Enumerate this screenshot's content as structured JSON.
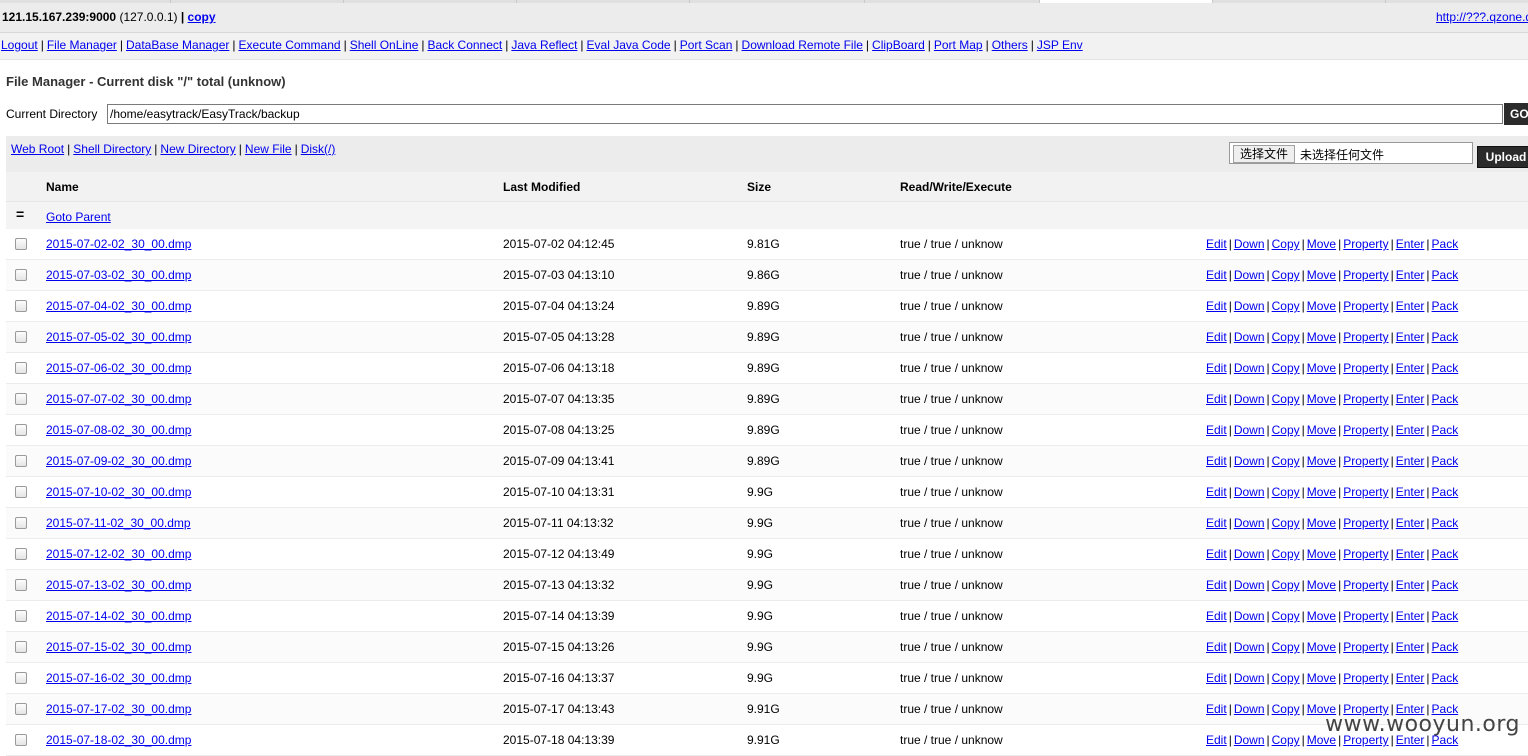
{
  "header": {
    "host": "121.15.167.239:9000",
    "local": "(127.0.0.1)",
    "divider": "|",
    "copy_label": "copy",
    "ext_link": "http://???.qzone.qq.com"
  },
  "nav": [
    "Logout",
    "File Manager",
    "DataBase Manager",
    "Execute Command",
    "Shell OnLine",
    "Back Connect",
    "Java Reflect",
    "Eval Java Code",
    "Port Scan",
    "Download Remote File",
    "ClipBoard",
    "Port Map",
    "Others",
    "JSP Env"
  ],
  "page_title": "File Manager - Current disk \"/\" total (unknow)",
  "current_dir": {
    "label": "Current Directory",
    "value": "/home/easytrack/EasyTrack/backup",
    "go_label": "GO"
  },
  "toolbar": {
    "links": [
      "Web Root",
      "Shell Directory",
      "New Directory",
      "New File",
      "Disk(/)"
    ],
    "choose_file_label": "选择文件",
    "no_file_text": "未选择任何文件",
    "upload_label": "Upload"
  },
  "table": {
    "headers": {
      "name": "Name",
      "modified": "Last Modified",
      "size": "Size",
      "rwx": "Read/Write/Execute"
    },
    "parent_icon": "=",
    "parent_label": "Goto Parent",
    "actions": [
      "Edit",
      "Down",
      "Copy",
      "Move",
      "Property",
      "Enter",
      "Pack"
    ],
    "rows": [
      {
        "name": "2015-07-02-02_30_00.dmp",
        "modified": "2015-07-02 04:12:45",
        "size": "9.81G",
        "rwx": "true / true / unknow"
      },
      {
        "name": "2015-07-03-02_30_00.dmp",
        "modified": "2015-07-03 04:13:10",
        "size": "9.86G",
        "rwx": "true / true / unknow"
      },
      {
        "name": "2015-07-04-02_30_00.dmp",
        "modified": "2015-07-04 04:13:24",
        "size": "9.89G",
        "rwx": "true / true / unknow"
      },
      {
        "name": "2015-07-05-02_30_00.dmp",
        "modified": "2015-07-05 04:13:28",
        "size": "9.89G",
        "rwx": "true / true / unknow"
      },
      {
        "name": "2015-07-06-02_30_00.dmp",
        "modified": "2015-07-06 04:13:18",
        "size": "9.89G",
        "rwx": "true / true / unknow"
      },
      {
        "name": "2015-07-07-02_30_00.dmp",
        "modified": "2015-07-07 04:13:35",
        "size": "9.89G",
        "rwx": "true / true / unknow"
      },
      {
        "name": "2015-07-08-02_30_00.dmp",
        "modified": "2015-07-08 04:13:25",
        "size": "9.89G",
        "rwx": "true / true / unknow"
      },
      {
        "name": "2015-07-09-02_30_00.dmp",
        "modified": "2015-07-09 04:13:41",
        "size": "9.89G",
        "rwx": "true / true / unknow"
      },
      {
        "name": "2015-07-10-02_30_00.dmp",
        "modified": "2015-07-10 04:13:31",
        "size": "9.9G",
        "rwx": "true / true / unknow"
      },
      {
        "name": "2015-07-11-02_30_00.dmp",
        "modified": "2015-07-11 04:13:32",
        "size": "9.9G",
        "rwx": "true / true / unknow"
      },
      {
        "name": "2015-07-12-02_30_00.dmp",
        "modified": "2015-07-12 04:13:49",
        "size": "9.9G",
        "rwx": "true / true / unknow"
      },
      {
        "name": "2015-07-13-02_30_00.dmp",
        "modified": "2015-07-13 04:13:32",
        "size": "9.9G",
        "rwx": "true / true / unknow"
      },
      {
        "name": "2015-07-14-02_30_00.dmp",
        "modified": "2015-07-14 04:13:39",
        "size": "9.9G",
        "rwx": "true / true / unknow"
      },
      {
        "name": "2015-07-15-02_30_00.dmp",
        "modified": "2015-07-15 04:13:26",
        "size": "9.9G",
        "rwx": "true / true / unknow"
      },
      {
        "name": "2015-07-16-02_30_00.dmp",
        "modified": "2015-07-16 04:13:37",
        "size": "9.9G",
        "rwx": "true / true / unknow"
      },
      {
        "name": "2015-07-17-02_30_00.dmp",
        "modified": "2015-07-17 04:13:43",
        "size": "9.91G",
        "rwx": "true / true / unknow"
      },
      {
        "name": "2015-07-18-02_30_00.dmp",
        "modified": "2015-07-18 04:13:39",
        "size": "9.91G",
        "rwx": "true / true / unknow"
      }
    ]
  },
  "watermark": "www.wooyun.org"
}
